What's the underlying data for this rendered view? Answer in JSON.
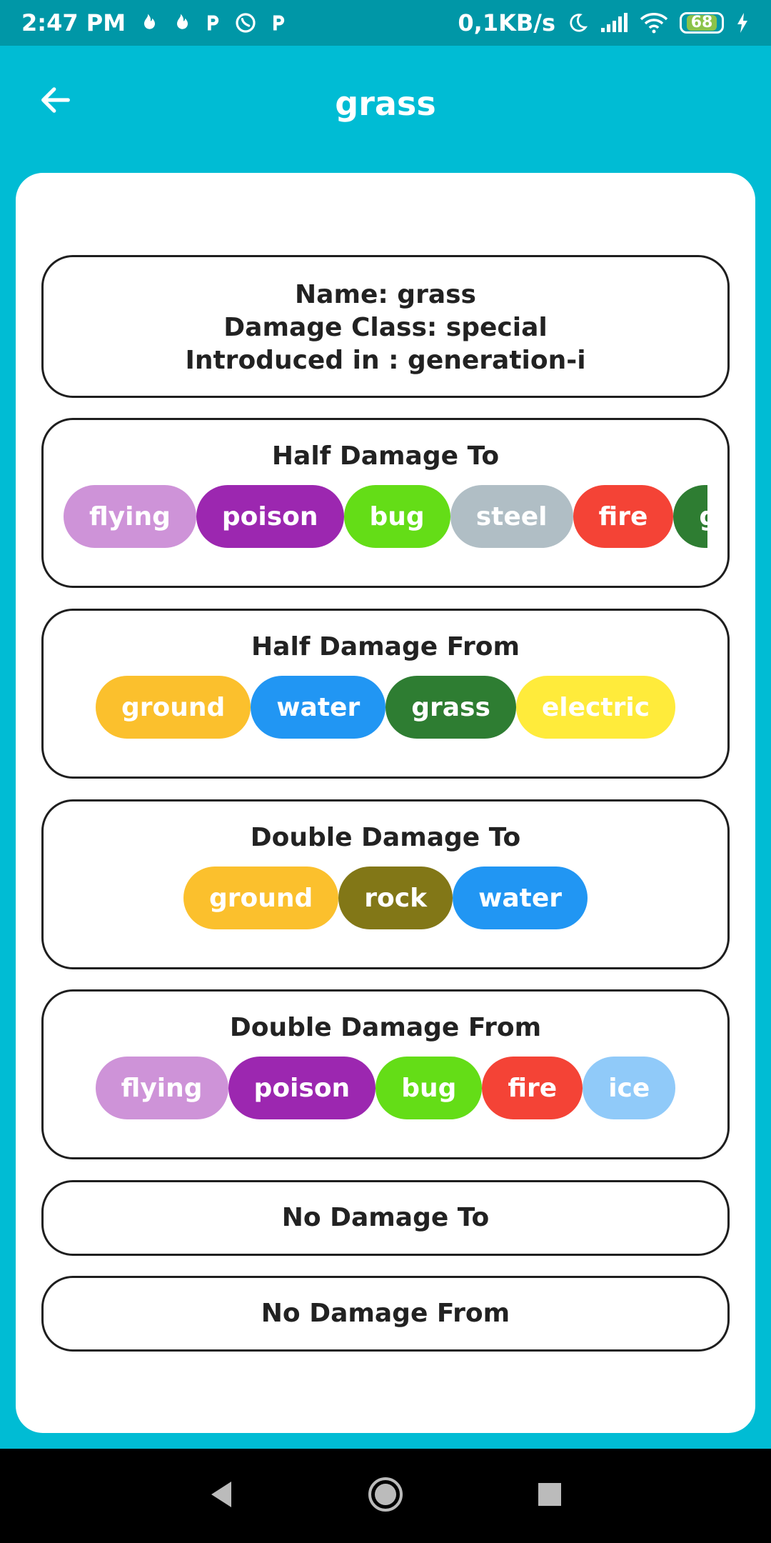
{
  "status_bar": {
    "time": "2:47 PM",
    "left_icons": [
      "fire-icon",
      "fire-icon",
      "p-icon",
      "whatsapp-icon",
      "p-icon"
    ],
    "speed": "0,1KB/s",
    "battery": "68",
    "right_icons": [
      "moon-icon",
      "signal-icon",
      "wifi-icon",
      "battery-icon",
      "charging-icon"
    ]
  },
  "header": {
    "title": "grass",
    "back_icon": "arrow-left-icon"
  },
  "info": {
    "name": "Name: grass",
    "damage_class": "Damage Class: special",
    "introduced": "Introduced in : generation-i"
  },
  "sections": {
    "half_damage_to": {
      "title": "Half Damage To",
      "chips": [
        {
          "label": "flying",
          "color": "#CE93D8"
        },
        {
          "label": "poison",
          "color": "#9C27B0"
        },
        {
          "label": "bug",
          "color": "#64DD17"
        },
        {
          "label": "steel",
          "color": "#B0BEC5"
        },
        {
          "label": "fire",
          "color": "#F44336"
        },
        {
          "label": "grass",
          "color": "#2E7D32"
        }
      ]
    },
    "half_damage_from": {
      "title": "Half Damage From",
      "chips": [
        {
          "label": "ground",
          "color": "#FBC02D"
        },
        {
          "label": "water",
          "color": "#2196F3"
        },
        {
          "label": "grass",
          "color": "#2E7D32"
        },
        {
          "label": "electric",
          "color": "#FFEB3B"
        }
      ]
    },
    "double_damage_to": {
      "title": "Double Damage To",
      "chips": [
        {
          "label": "ground",
          "color": "#FBC02D"
        },
        {
          "label": "rock",
          "color": "#827717"
        },
        {
          "label": "water",
          "color": "#2196F3"
        }
      ]
    },
    "double_damage_from": {
      "title": "Double Damage From",
      "chips": [
        {
          "label": "flying",
          "color": "#CE93D8"
        },
        {
          "label": "poison",
          "color": "#9C27B0"
        },
        {
          "label": "bug",
          "color": "#64DD17"
        },
        {
          "label": "fire",
          "color": "#F44336"
        },
        {
          "label": "ice",
          "color": "#90CAF9"
        }
      ]
    },
    "no_damage_to": {
      "title": "No Damage To"
    },
    "no_damage_from": {
      "title": "No Damage From"
    }
  },
  "nav": {
    "back": "triangle-back-icon",
    "home": "circle-home-icon",
    "recents": "square-recents-icon"
  }
}
